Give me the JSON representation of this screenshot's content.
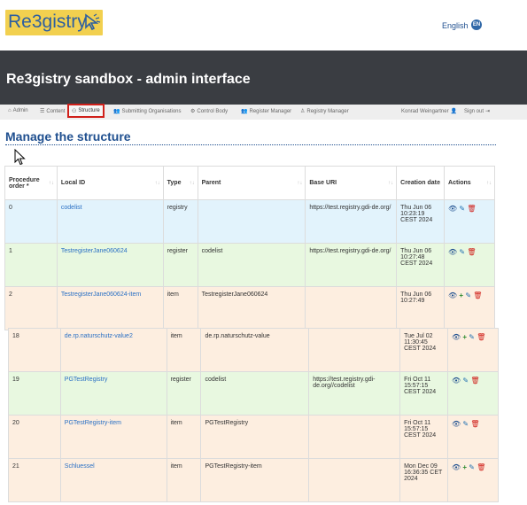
{
  "header": {
    "logo_text": "Re3gistry",
    "language": "English",
    "language_badge": "EN"
  },
  "banner": {
    "title": "Re3gistry sandbox - admin interface"
  },
  "nav": {
    "items": [
      {
        "icon": "home-icon",
        "label": "Admin"
      },
      {
        "icon": "list-icon",
        "label": "Content"
      },
      {
        "icon": "sitemap-icon",
        "label": "Structure"
      },
      {
        "icon": "users-icon",
        "label": "Submitting Organisations"
      },
      {
        "icon": "user-cog-icon",
        "label": "Control Body"
      },
      {
        "icon": "users-cog-icon",
        "label": "Register Manager"
      },
      {
        "icon": "user-tie-icon",
        "label": "Registry Manager"
      }
    ],
    "user": "Konrad Weingartner",
    "signout": "Sign out"
  },
  "page_title": "Manage the structure",
  "table": {
    "headers": [
      "Procedure order *",
      "Local ID",
      "Type",
      "Parent",
      "Base URI",
      "Creation date",
      "Actions"
    ],
    "rows": [
      {
        "order": "0",
        "local_id": "codelist",
        "type": "registry",
        "parent": "",
        "base_uri": "https://test.registry.gdi-de.org/",
        "date": "Thu Jun 06 10:23:19 CEST 2024",
        "kind": "registry",
        "plus": false
      },
      {
        "order": "1",
        "local_id": "TestregisterJane060624",
        "type": "register",
        "parent": "codelist",
        "base_uri": "https://test.registry.gdi-de.org/",
        "date": "Thu Jun 06 10:27:48 CEST 2024",
        "kind": "register",
        "plus": false
      },
      {
        "order": "2",
        "local_id": "TestregisterJane060624-item",
        "type": "item",
        "parent": "TestregisterJane060624",
        "base_uri": "",
        "date": "Thu Jun 06 10:27:49",
        "kind": "item",
        "plus": true
      }
    ],
    "rows2": [
      {
        "order": "18",
        "local_id": "de.rp.naturschutz-value2",
        "type": "item",
        "parent": "de.rp.naturschutz-value",
        "base_uri": "",
        "date": "Tue Jul 02 11:30:45 CEST 2024",
        "kind": "item",
        "plus": true
      },
      {
        "order": "19",
        "local_id": "PGTestRegistry",
        "type": "register",
        "parent": "codelist",
        "base_uri": "https://test.registry.gdi-de.org//codelist",
        "date": "Fri Oct 11 15:57:15 CEST 2024",
        "kind": "register",
        "plus": false
      },
      {
        "order": "20",
        "local_id": "PGTestRegistry-item",
        "type": "item",
        "parent": "PGTestRegistry",
        "base_uri": "",
        "date": "Fri Oct 11 15:57:15 CEST 2024",
        "kind": "item",
        "plus": false
      },
      {
        "order": "21",
        "local_id": "Schluessel",
        "type": "item",
        "parent": "PGTestRegistry-item",
        "base_uri": "",
        "date": "Mon Dec 09 16:36:35 CET 2024",
        "kind": "item",
        "plus": true
      }
    ]
  }
}
